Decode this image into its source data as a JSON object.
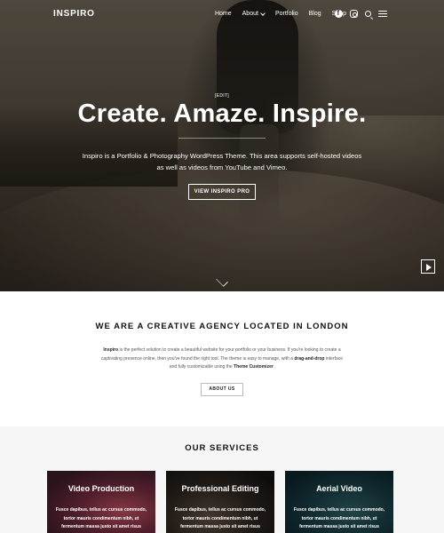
{
  "nav": {
    "logo": "INSPIRO",
    "items": [
      {
        "label": "Home"
      },
      {
        "label": "About"
      },
      {
        "label": "Portfolio"
      },
      {
        "label": "Blog"
      },
      {
        "label": "Shop"
      }
    ],
    "icons": [
      "facebook-icon",
      "instagram-icon",
      "search-icon",
      "menu-icon"
    ]
  },
  "hero": {
    "edit_label": "[EDIT]",
    "headline": "Create. Amaze. Inspire.",
    "subtitle": "Inspiro is a Portfolio & Photography WordPress Theme. This area supports self-hosted videos as well as videos from YouTube and Vimeo.",
    "cta_label": "VIEW INSPIRO PRO"
  },
  "about": {
    "title": "WE ARE A CREATIVE AGENCY LOCATED IN LONDON",
    "text_parts": {
      "brand": "Inspiro",
      "p1": " is the perfect solution to create a beautiful website for your portfolio or your business. If you're looking to create a captivating presence online, then you've found the right tool. The theme is easy to manage, with a ",
      "dnd": "drag-and-drop",
      "p2": " interface and fully customizable using the ",
      "customizer": "Theme Customizer",
      "p3": "."
    },
    "button_label": "ABOUT US"
  },
  "services": {
    "title": "OUR SERVICES",
    "cards": [
      {
        "title": "Video Production",
        "text": "Fusce dapibus, tellus ac cursus commodo, tortor mauris condimentum nibh, ut fermentum massa justo sit amet risus"
      },
      {
        "title": "Professional Editing",
        "text": "Fusce dapibus, tellus ac cursus commodo, tortor mauris condimentum nibh, ut fermentum massa justo sit amet risus"
      },
      {
        "title": "Aerial Video",
        "text": "Fusce dapibus, tellus ac cursus commodo, tortor mauris condimentum nibh, ut fermentum massa justo sit amet risus"
      }
    ]
  }
}
